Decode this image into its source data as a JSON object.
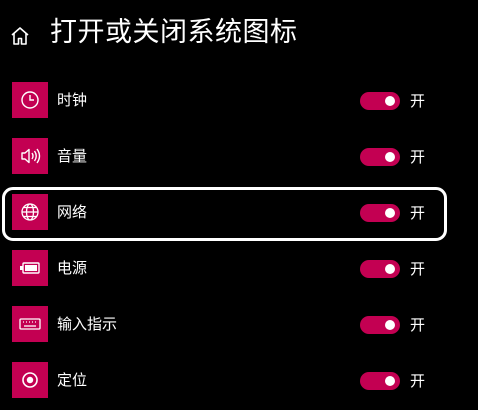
{
  "header": {
    "icon": "home-icon",
    "title": "打开或关闭系统图标"
  },
  "items": [
    {
      "icon": "clock-icon",
      "label": "时钟",
      "state": "开",
      "on": true
    },
    {
      "icon": "volume-icon",
      "label": "音量",
      "state": "开",
      "on": true
    },
    {
      "icon": "globe-icon",
      "label": "网络",
      "state": "开",
      "on": true
    },
    {
      "icon": "battery-icon",
      "label": "电源",
      "state": "开",
      "on": true
    },
    {
      "icon": "keyboard-icon",
      "label": "输入指示",
      "state": "开",
      "on": true
    },
    {
      "icon": "location-icon",
      "label": "定位",
      "state": "开",
      "on": true
    }
  ],
  "colors": {
    "background": "#000000",
    "accent": "#c30052",
    "text": "#ffffff",
    "highlight": "#ffffff"
  }
}
